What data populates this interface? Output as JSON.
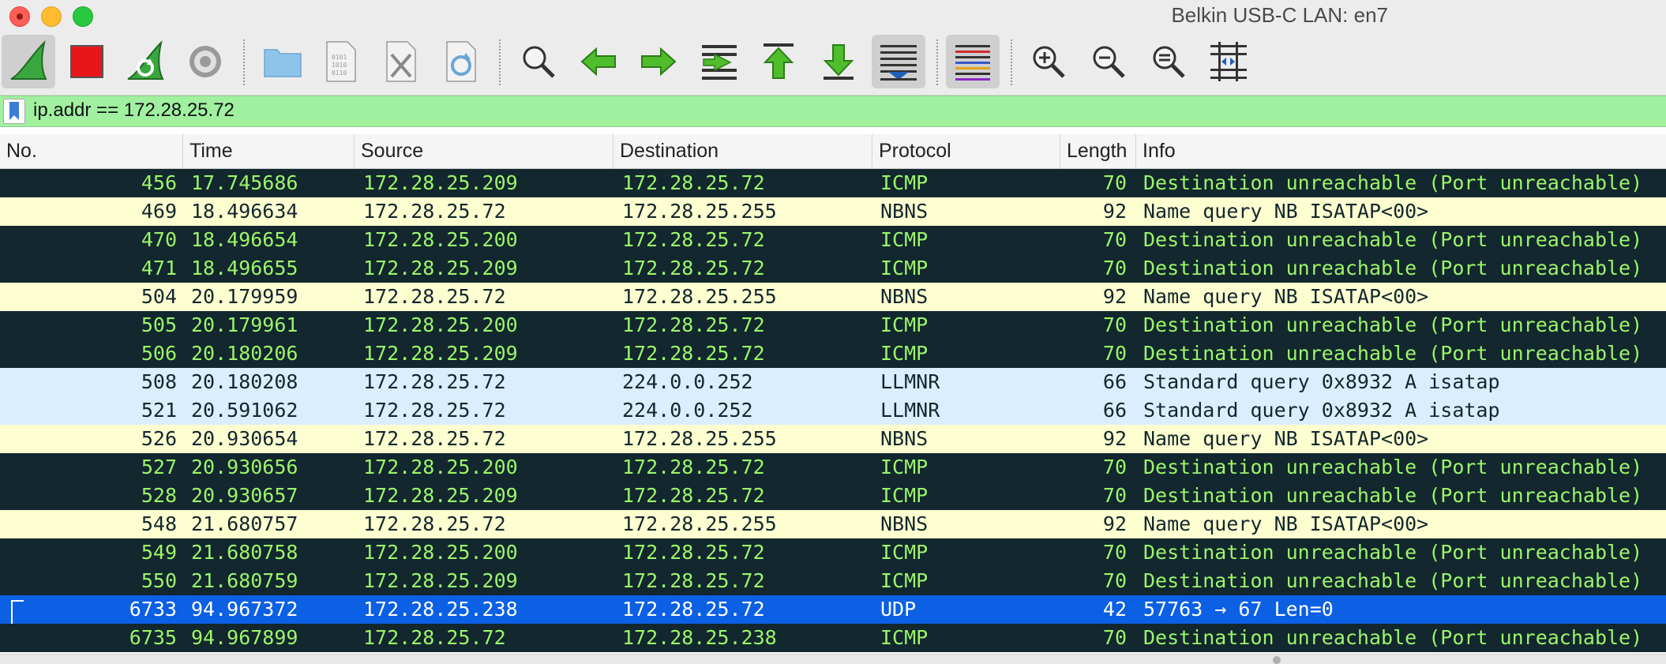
{
  "window": {
    "title": "Belkin USB-C LAN: en7"
  },
  "toolbar": {
    "buttons": [
      {
        "name": "start-capture",
        "icon": "shark-fin-icon",
        "active": true
      },
      {
        "name": "stop-capture",
        "icon": "stop-icon"
      },
      {
        "name": "restart-capture",
        "icon": "restart-fin-icon"
      },
      {
        "name": "capture-options",
        "icon": "gear-icon"
      },
      {
        "name": "open-file",
        "icon": "folder-icon"
      },
      {
        "name": "save-file",
        "icon": "binary-file-icon"
      },
      {
        "name": "close-file",
        "icon": "close-file-icon"
      },
      {
        "name": "reload-file",
        "icon": "reload-file-icon"
      },
      {
        "name": "find-packet",
        "icon": "magnifier-icon"
      },
      {
        "name": "go-back",
        "icon": "arrow-left-icon"
      },
      {
        "name": "go-forward",
        "icon": "arrow-right-icon"
      },
      {
        "name": "go-to-packet",
        "icon": "jump-icon"
      },
      {
        "name": "go-first",
        "icon": "arrow-up-bar-icon"
      },
      {
        "name": "go-last",
        "icon": "arrow-down-bar-icon"
      },
      {
        "name": "autoscroll",
        "icon": "autoscroll-icon",
        "active": true
      },
      {
        "name": "colorize",
        "icon": "colorize-lines-icon",
        "active": true
      },
      {
        "name": "zoom-in",
        "icon": "zoom-in-icon"
      },
      {
        "name": "zoom-out",
        "icon": "zoom-out-icon"
      },
      {
        "name": "normal-size",
        "icon": "zoom-normal-icon"
      },
      {
        "name": "resize-columns",
        "icon": "resize-columns-icon"
      }
    ]
  },
  "filter": {
    "value": "ip.addr == 172.28.25.72",
    "valid_color": "#a0f0a0"
  },
  "columns": {
    "no": "No.",
    "time": "Time",
    "source": "Source",
    "destination": "Destination",
    "protocol": "Protocol",
    "length": "Length",
    "info": "Info"
  },
  "colors": {
    "icmp_bg": "#12272e",
    "icmp_fg": "#9cf56a",
    "nbns_bg": "#feffd0",
    "llmnr_bg": "#daeeff",
    "selected_bg": "#0b60e3"
  },
  "packets": [
    {
      "no": "456",
      "time": "17.745686",
      "source": "172.28.25.209",
      "destination": "172.28.25.72",
      "protocol": "ICMP",
      "length": "70",
      "info": "Destination unreachable (Port unreachable)",
      "kind": "icmp"
    },
    {
      "no": "469",
      "time": "18.496634",
      "source": "172.28.25.72",
      "destination": "172.28.25.255",
      "protocol": "NBNS",
      "length": "92",
      "info": "Name query NB ISATAP<00>",
      "kind": "nbns"
    },
    {
      "no": "470",
      "time": "18.496654",
      "source": "172.28.25.200",
      "destination": "172.28.25.72",
      "protocol": "ICMP",
      "length": "70",
      "info": "Destination unreachable (Port unreachable)",
      "kind": "icmp"
    },
    {
      "no": "471",
      "time": "18.496655",
      "source": "172.28.25.209",
      "destination": "172.28.25.72",
      "protocol": "ICMP",
      "length": "70",
      "info": "Destination unreachable (Port unreachable)",
      "kind": "icmp"
    },
    {
      "no": "504",
      "time": "20.179959",
      "source": "172.28.25.72",
      "destination": "172.28.25.255",
      "protocol": "NBNS",
      "length": "92",
      "info": "Name query NB ISATAP<00>",
      "kind": "nbns"
    },
    {
      "no": "505",
      "time": "20.179961",
      "source": "172.28.25.200",
      "destination": "172.28.25.72",
      "protocol": "ICMP",
      "length": "70",
      "info": "Destination unreachable (Port unreachable)",
      "kind": "icmp"
    },
    {
      "no": "506",
      "time": "20.180206",
      "source": "172.28.25.209",
      "destination": "172.28.25.72",
      "protocol": "ICMP",
      "length": "70",
      "info": "Destination unreachable (Port unreachable)",
      "kind": "icmp"
    },
    {
      "no": "508",
      "time": "20.180208",
      "source": "172.28.25.72",
      "destination": "224.0.0.252",
      "protocol": "LLMNR",
      "length": "66",
      "info": "Standard query 0x8932 A isatap",
      "kind": "llmnr"
    },
    {
      "no": "521",
      "time": "20.591062",
      "source": "172.28.25.72",
      "destination": "224.0.0.252",
      "protocol": "LLMNR",
      "length": "66",
      "info": "Standard query 0x8932 A isatap",
      "kind": "llmnr"
    },
    {
      "no": "526",
      "time": "20.930654",
      "source": "172.28.25.72",
      "destination": "172.28.25.255",
      "protocol": "NBNS",
      "length": "92",
      "info": "Name query NB ISATAP<00>",
      "kind": "nbns"
    },
    {
      "no": "527",
      "time": "20.930656",
      "source": "172.28.25.200",
      "destination": "172.28.25.72",
      "protocol": "ICMP",
      "length": "70",
      "info": "Destination unreachable (Port unreachable)",
      "kind": "icmp"
    },
    {
      "no": "528",
      "time": "20.930657",
      "source": "172.28.25.209",
      "destination": "172.28.25.72",
      "protocol": "ICMP",
      "length": "70",
      "info": "Destination unreachable (Port unreachable)",
      "kind": "icmp"
    },
    {
      "no": "548",
      "time": "21.680757",
      "source": "172.28.25.72",
      "destination": "172.28.25.255",
      "protocol": "NBNS",
      "length": "92",
      "info": "Name query NB ISATAP<00>",
      "kind": "nbns"
    },
    {
      "no": "549",
      "time": "21.680758",
      "source": "172.28.25.200",
      "destination": "172.28.25.72",
      "protocol": "ICMP",
      "length": "70",
      "info": "Destination unreachable (Port unreachable)",
      "kind": "icmp"
    },
    {
      "no": "550",
      "time": "21.680759",
      "source": "172.28.25.209",
      "destination": "172.28.25.72",
      "protocol": "ICMP",
      "length": "70",
      "info": "Destination unreachable (Port unreachable)",
      "kind": "icmp"
    },
    {
      "no": "6733",
      "time": "94.967372",
      "source": "172.28.25.238",
      "destination": "172.28.25.72",
      "protocol": "UDP",
      "length": "42",
      "info": "57763 → 67 Len=0",
      "kind": "selected"
    },
    {
      "no": "6735",
      "time": "94.967899",
      "source": "172.28.25.72",
      "destination": "172.28.25.238",
      "protocol": "ICMP",
      "length": "70",
      "info": "Destination unreachable (Port unreachable)",
      "kind": "icmp"
    }
  ]
}
